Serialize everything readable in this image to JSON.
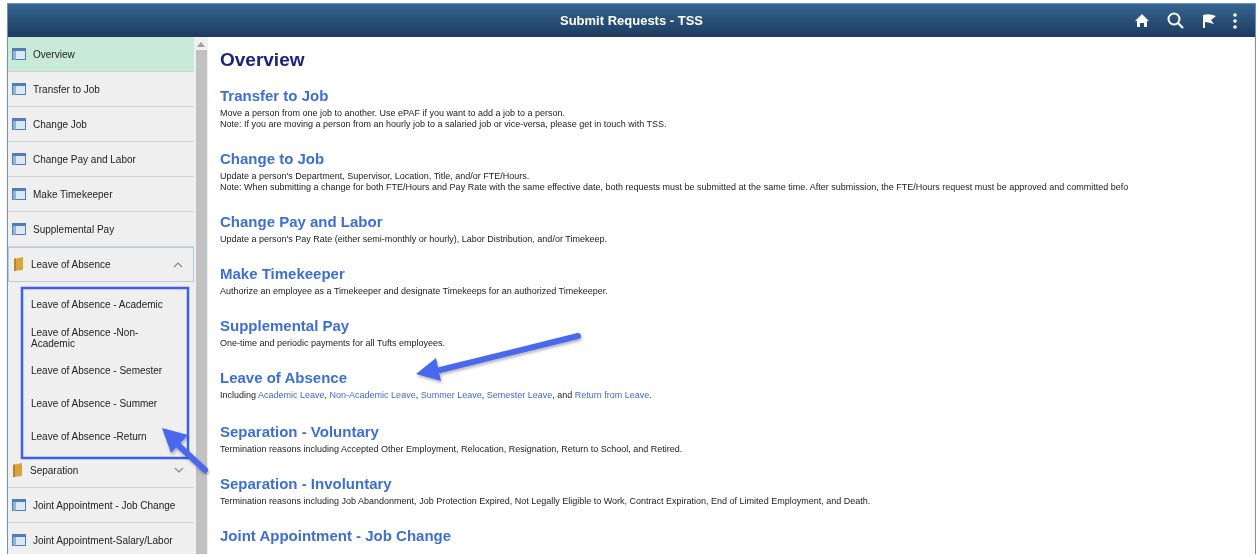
{
  "window": {
    "title": "Submit Requests - TSS"
  },
  "sidebar": {
    "items": [
      {
        "label": "Overview",
        "kind": "page",
        "selected": true
      },
      {
        "label": "Transfer to Job",
        "kind": "page",
        "selected": false
      },
      {
        "label": "Change Job",
        "kind": "page",
        "selected": false
      },
      {
        "label": "Change Pay and Labor",
        "kind": "page",
        "selected": false
      },
      {
        "label": "Make Timekeeper",
        "kind": "page",
        "selected": false
      },
      {
        "label": "Supplemental Pay",
        "kind": "page",
        "selected": false
      },
      {
        "label": "Leave of Absence",
        "kind": "folder",
        "selected": false,
        "expanded": true,
        "children": [
          {
            "label": "Leave of Absence - Academic",
            "selected": false
          },
          {
            "label": "Leave of Absence -Non-Academic",
            "selected": false
          },
          {
            "label": "Leave of Absence - Semester",
            "selected": false
          },
          {
            "label": "Leave of Absence - Summer",
            "selected": false
          },
          {
            "label": "Leave of Absence -Return",
            "selected": false
          }
        ]
      },
      {
        "label": "Separation",
        "kind": "folder",
        "selected": false,
        "expanded": false
      },
      {
        "label": "Joint Appointment - Job Change",
        "kind": "page",
        "selected": false
      },
      {
        "label": "Joint Appointment-Salary/Labor",
        "kind": "page",
        "selected": false
      }
    ]
  },
  "content": {
    "title": "Overview",
    "sections": [
      {
        "heading": "Transfer to Job",
        "lines": [
          "Move a person from one job to another. Use ePAF if you want to add a job to a person.",
          "Note: If you are moving a person from an hourly job to a salaried job or vice-versa, please get in touch with TSS."
        ]
      },
      {
        "heading": "Change to Job",
        "lines": [
          "Update a person's Department, Supervisor, Location, Title, and/or FTE/Hours.",
          "Note: When submitting a change for both FTE/Hours and Pay Rate with the same effective date, both requests must be submitted at the same time. After submission, the FTE/Hours request must be approved and committed befo"
        ]
      },
      {
        "heading": "Change Pay and Labor",
        "lines": [
          "Update a person's Pay Rate (either semi-monthly or hourly), Labor Distribution, and/or Timekeep."
        ]
      },
      {
        "heading": "Make Timekeeper",
        "lines": [
          "Authorize an employee as a Timekeeper and designate Timekeeps for an authorized Timekeeper."
        ]
      },
      {
        "heading": "Supplemental Pay",
        "lines": [
          "One-time and periodic payments for all Tufts employees."
        ]
      },
      {
        "heading": "Leave of Absence",
        "lines": [
          [
            {
              "text": "Including ",
              "kind": "plain"
            },
            {
              "text": "Academic Leave",
              "kind": "link"
            },
            {
              "text": ", ",
              "kind": "plain"
            },
            {
              "text": "Non-Academic Leave",
              "kind": "link"
            },
            {
              "text": ", ",
              "kind": "plain"
            },
            {
              "text": "Summer Leave",
              "kind": "link"
            },
            {
              "text": ", ",
              "kind": "plain"
            },
            {
              "text": "Semester Leave",
              "kind": "link"
            },
            {
              "text": ", and ",
              "kind": "plain"
            },
            {
              "text": "Return from Leave",
              "kind": "link"
            },
            {
              "text": ".",
              "kind": "plain"
            }
          ]
        ]
      },
      {
        "heading": "Separation - Voluntary",
        "lines": [
          "Termination reasons including Accepted Other Employment, Relocation, Resignation, Return to School, and Retired."
        ]
      },
      {
        "heading": "Separation - Involuntary",
        "lines": [
          "Termination reasons including Job Abandonment, Job Protection Expired, Not Legally Eligible to Work, Contract Expiration, End of Limited Employment, and Death."
        ]
      },
      {
        "heading": "Joint Appointment - Job Change"
      }
    ]
  }
}
